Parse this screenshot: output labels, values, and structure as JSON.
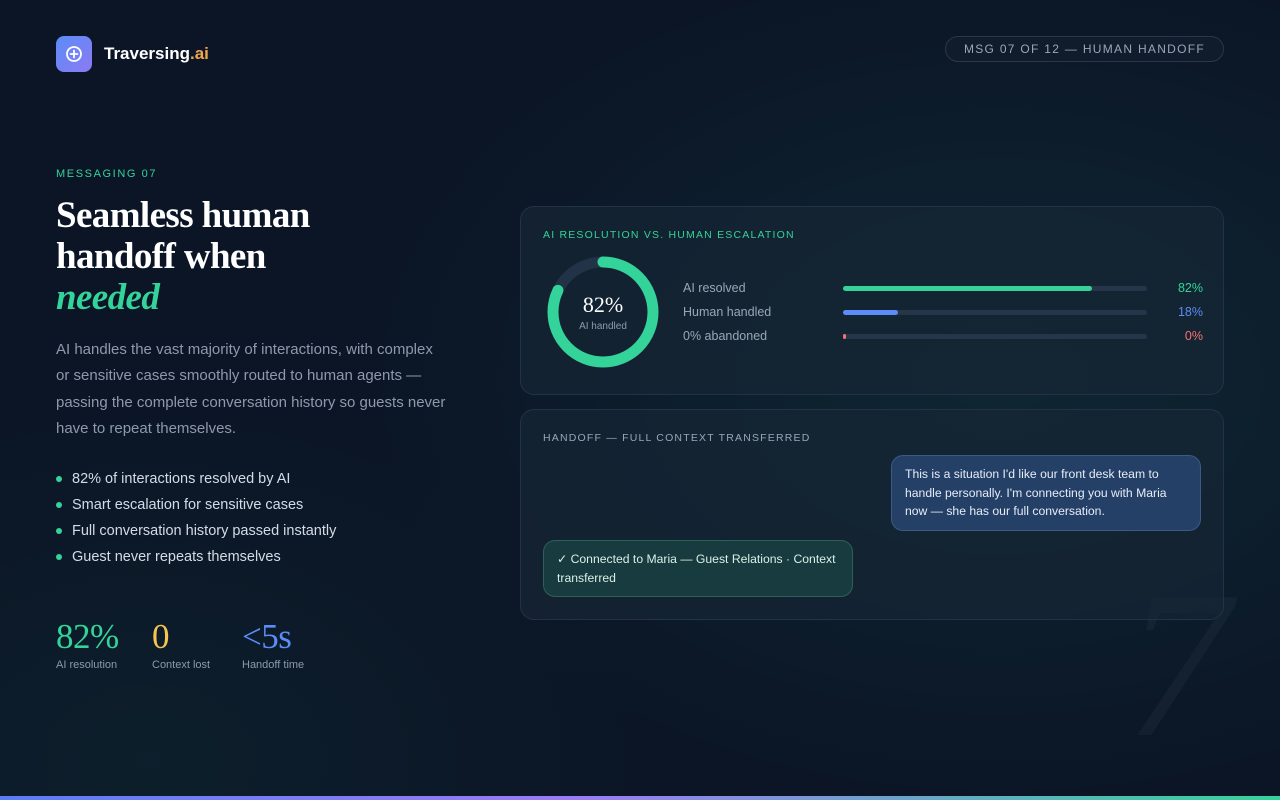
{
  "brand": {
    "name_main": "Traversing",
    "name_accent": ".ai",
    "logo_icon": "compass-icon",
    "colors": {
      "accent_green": "#34d399",
      "accent_blue": "#5b8cf7",
      "accent_yellow": "#f5c451",
      "accent_red": "#f87171"
    }
  },
  "header": {
    "pill": "MSG 07 OF 12 — HUMAN HANDOFF"
  },
  "hero": {
    "eyebrow": "MESSAGING 07",
    "headline_line1": "Seamless human",
    "headline_line2": "handoff when",
    "headline_italic": "needed",
    "lede": "AI handles the vast majority of interactions, with complex or sensitive cases smoothly routed to human agents — passing the complete conversation history so guests never have to repeat themselves."
  },
  "bullets": [
    "82% of interactions resolved by AI",
    "Smart escalation for sensitive cases",
    "Full conversation history passed instantly",
    "Guest never repeats themselves"
  ],
  "stats": [
    {
      "value": "82%",
      "label": "AI resolution",
      "color": "#34d399"
    },
    {
      "value": "0",
      "label": "Context lost",
      "color": "#f5c451"
    },
    {
      "value": "<5s",
      "label": "Handoff time",
      "color": "#5b8cf7"
    }
  ],
  "resolution_card": {
    "title": "AI RESOLUTION VS. HUMAN ESCALATION",
    "donut": {
      "value": "82%",
      "fraction": 0.82,
      "label": "AI handled",
      "color": "#34d399"
    },
    "rows": [
      {
        "label": "AI resolved",
        "value": "82%",
        "fraction": 0.82,
        "color": "#34d399"
      },
      {
        "label": "Human handled",
        "value": "18%",
        "fraction": 0.18,
        "color": "#5b8cf7"
      },
      {
        "label": "0% abandoned",
        "value": "0%",
        "fraction": 0.0,
        "color": "#f87171"
      }
    ]
  },
  "handoff_card": {
    "title": "HANDOFF — FULL CONTEXT TRANSFERRED",
    "agent_message": "This is a situation I'd like our front desk team to handle personally. I'm connecting you with Maria now — she has our full conversation.",
    "system_message": "✓ Connected to Maria — Guest Relations · Context transferred"
  },
  "decor": {
    "big_number": "7"
  }
}
